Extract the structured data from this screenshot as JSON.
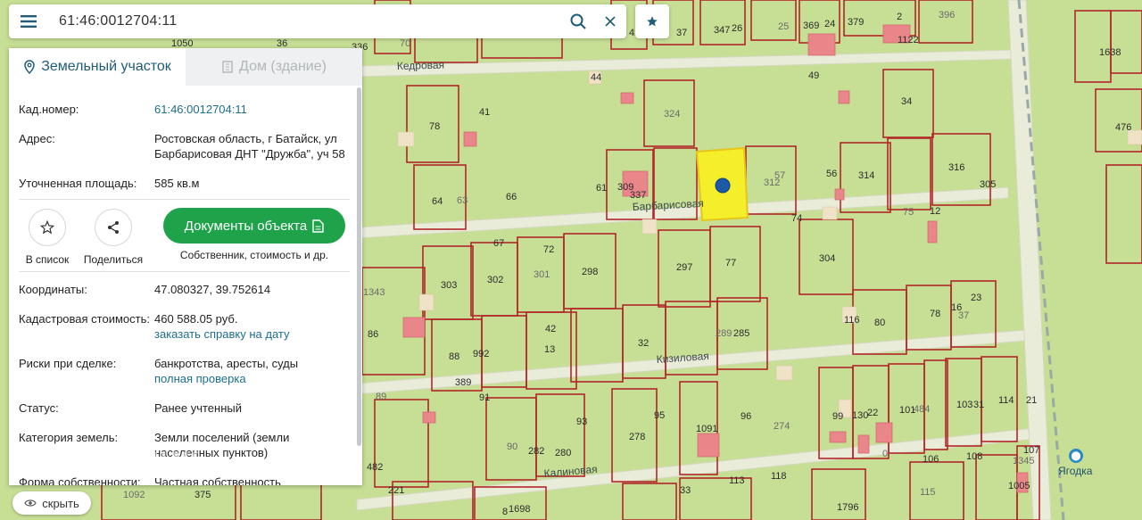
{
  "search": {
    "query": "61:46:0012704:11"
  },
  "tabs": {
    "land": "Земельный участок",
    "house": "Дом (здание)"
  },
  "info": {
    "cad_label": "Кад.номер:",
    "cad_value": "61:46:0012704:11",
    "addr_label": "Адрес:",
    "addr_value": "Ростовская область, г Батайск, ул Барбарисовая ДНТ \"Дружба\", уч 58",
    "area_label": "Уточненная площадь:",
    "area_value": "585 кв.м",
    "coords_label": "Координаты:",
    "coords_value": "47.080327, 39.752614",
    "cost_label": "Кадастровая стоимость:",
    "cost_value": "460 588.05 руб.",
    "cost_link": "заказать справку на дату",
    "risk_label": "Риски при сделке:",
    "risk_value": "банкротства, аресты, суды",
    "risk_link": "полная проверка",
    "status_label": "Статус:",
    "status_value": "Ранее учтенный",
    "cat_label": "Категория земель:",
    "cat_value": "Земли поселений (земли населенных пунктов)",
    "own_label": "Форма собственности:",
    "own_value": "Частная собственность"
  },
  "actions": {
    "list": "В список",
    "share": "Поделиться",
    "docs": "Документы объекта",
    "docs_sub": "Собственник, стоимость и др."
  },
  "hide_label": "скрыть",
  "watermark": "ДОМКЛИК",
  "map": {
    "streets": [
      "Кедровая",
      "Барбарисовая",
      "Кизиловая",
      "Калиновая"
    ],
    "poi": "Ягодка",
    "lot_numbers": [
      "1050",
      "36",
      "336",
      "70",
      "42",
      "37",
      "347",
      "26",
      "25",
      "369",
      "24",
      "379",
      "2",
      "396",
      "1122",
      "1638",
      "44",
      "49",
      "324",
      "41",
      "78",
      "34",
      "476",
      "57",
      "56",
      "61",
      "309",
      "337",
      "312",
      "314",
      "316",
      "305",
      "64",
      "63",
      "66",
      "67",
      "72",
      "74",
      "75",
      "12",
      "304",
      "303",
      "302",
      "301",
      "298",
      "297",
      "77",
      "23",
      "37",
      "78",
      "16",
      "80",
      "116",
      "1343",
      "86",
      "42",
      "13",
      "32",
      "289",
      "285",
      "88",
      "992",
      "389",
      "89",
      "91",
      "93",
      "95",
      "96",
      "274",
      "99",
      "130",
      "22",
      "101",
      "484",
      "103",
      "31",
      "114",
      "21",
      "90",
      "282",
      "280",
      "278",
      "1091",
      "1092",
      "375",
      "10",
      "221",
      "482",
      "115",
      "113",
      "118",
      "33",
      "1796",
      "1345",
      "1005",
      "107",
      "108",
      "106",
      "0",
      "8",
      "1698"
    ],
    "colors": {
      "land": "#c7df95",
      "plot_border": "#b3262a",
      "selected": "#f5ee2a",
      "marker": "#1c5aa8",
      "accent": "#1ea24a"
    }
  }
}
